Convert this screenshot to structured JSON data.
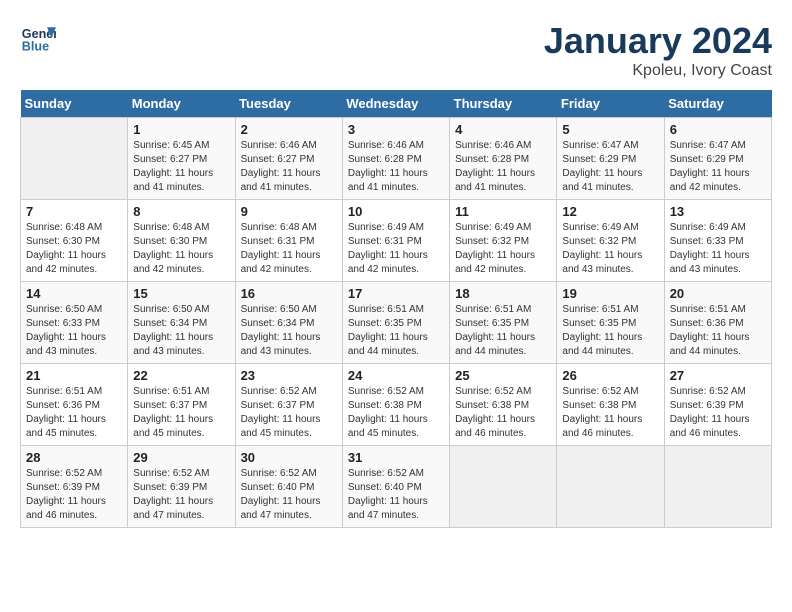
{
  "header": {
    "logo_line1": "General",
    "logo_line2": "Blue",
    "month": "January 2024",
    "location": "Kpoleu, Ivory Coast"
  },
  "days_of_week": [
    "Sunday",
    "Monday",
    "Tuesday",
    "Wednesday",
    "Thursday",
    "Friday",
    "Saturday"
  ],
  "weeks": [
    [
      {
        "day": "",
        "sunrise": "",
        "sunset": "",
        "daylight": ""
      },
      {
        "day": "1",
        "sunrise": "Sunrise: 6:45 AM",
        "sunset": "Sunset: 6:27 PM",
        "daylight": "Daylight: 11 hours and 41 minutes."
      },
      {
        "day": "2",
        "sunrise": "Sunrise: 6:46 AM",
        "sunset": "Sunset: 6:27 PM",
        "daylight": "Daylight: 11 hours and 41 minutes."
      },
      {
        "day": "3",
        "sunrise": "Sunrise: 6:46 AM",
        "sunset": "Sunset: 6:28 PM",
        "daylight": "Daylight: 11 hours and 41 minutes."
      },
      {
        "day": "4",
        "sunrise": "Sunrise: 6:46 AM",
        "sunset": "Sunset: 6:28 PM",
        "daylight": "Daylight: 11 hours and 41 minutes."
      },
      {
        "day": "5",
        "sunrise": "Sunrise: 6:47 AM",
        "sunset": "Sunset: 6:29 PM",
        "daylight": "Daylight: 11 hours and 41 minutes."
      },
      {
        "day": "6",
        "sunrise": "Sunrise: 6:47 AM",
        "sunset": "Sunset: 6:29 PM",
        "daylight": "Daylight: 11 hours and 42 minutes."
      }
    ],
    [
      {
        "day": "7",
        "sunrise": "Sunrise: 6:48 AM",
        "sunset": "Sunset: 6:30 PM",
        "daylight": "Daylight: 11 hours and 42 minutes."
      },
      {
        "day": "8",
        "sunrise": "Sunrise: 6:48 AM",
        "sunset": "Sunset: 6:30 PM",
        "daylight": "Daylight: 11 hours and 42 minutes."
      },
      {
        "day": "9",
        "sunrise": "Sunrise: 6:48 AM",
        "sunset": "Sunset: 6:31 PM",
        "daylight": "Daylight: 11 hours and 42 minutes."
      },
      {
        "day": "10",
        "sunrise": "Sunrise: 6:49 AM",
        "sunset": "Sunset: 6:31 PM",
        "daylight": "Daylight: 11 hours and 42 minutes."
      },
      {
        "day": "11",
        "sunrise": "Sunrise: 6:49 AM",
        "sunset": "Sunset: 6:32 PM",
        "daylight": "Daylight: 11 hours and 42 minutes."
      },
      {
        "day": "12",
        "sunrise": "Sunrise: 6:49 AM",
        "sunset": "Sunset: 6:32 PM",
        "daylight": "Daylight: 11 hours and 43 minutes."
      },
      {
        "day": "13",
        "sunrise": "Sunrise: 6:49 AM",
        "sunset": "Sunset: 6:33 PM",
        "daylight": "Daylight: 11 hours and 43 minutes."
      }
    ],
    [
      {
        "day": "14",
        "sunrise": "Sunrise: 6:50 AM",
        "sunset": "Sunset: 6:33 PM",
        "daylight": "Daylight: 11 hours and 43 minutes."
      },
      {
        "day": "15",
        "sunrise": "Sunrise: 6:50 AM",
        "sunset": "Sunset: 6:34 PM",
        "daylight": "Daylight: 11 hours and 43 minutes."
      },
      {
        "day": "16",
        "sunrise": "Sunrise: 6:50 AM",
        "sunset": "Sunset: 6:34 PM",
        "daylight": "Daylight: 11 hours and 43 minutes."
      },
      {
        "day": "17",
        "sunrise": "Sunrise: 6:51 AM",
        "sunset": "Sunset: 6:35 PM",
        "daylight": "Daylight: 11 hours and 44 minutes."
      },
      {
        "day": "18",
        "sunrise": "Sunrise: 6:51 AM",
        "sunset": "Sunset: 6:35 PM",
        "daylight": "Daylight: 11 hours and 44 minutes."
      },
      {
        "day": "19",
        "sunrise": "Sunrise: 6:51 AM",
        "sunset": "Sunset: 6:35 PM",
        "daylight": "Daylight: 11 hours and 44 minutes."
      },
      {
        "day": "20",
        "sunrise": "Sunrise: 6:51 AM",
        "sunset": "Sunset: 6:36 PM",
        "daylight": "Daylight: 11 hours and 44 minutes."
      }
    ],
    [
      {
        "day": "21",
        "sunrise": "Sunrise: 6:51 AM",
        "sunset": "Sunset: 6:36 PM",
        "daylight": "Daylight: 11 hours and 45 minutes."
      },
      {
        "day": "22",
        "sunrise": "Sunrise: 6:51 AM",
        "sunset": "Sunset: 6:37 PM",
        "daylight": "Daylight: 11 hours and 45 minutes."
      },
      {
        "day": "23",
        "sunrise": "Sunrise: 6:52 AM",
        "sunset": "Sunset: 6:37 PM",
        "daylight": "Daylight: 11 hours and 45 minutes."
      },
      {
        "day": "24",
        "sunrise": "Sunrise: 6:52 AM",
        "sunset": "Sunset: 6:38 PM",
        "daylight": "Daylight: 11 hours and 45 minutes."
      },
      {
        "day": "25",
        "sunrise": "Sunrise: 6:52 AM",
        "sunset": "Sunset: 6:38 PM",
        "daylight": "Daylight: 11 hours and 46 minutes."
      },
      {
        "day": "26",
        "sunrise": "Sunrise: 6:52 AM",
        "sunset": "Sunset: 6:38 PM",
        "daylight": "Daylight: 11 hours and 46 minutes."
      },
      {
        "day": "27",
        "sunrise": "Sunrise: 6:52 AM",
        "sunset": "Sunset: 6:39 PM",
        "daylight": "Daylight: 11 hours and 46 minutes."
      }
    ],
    [
      {
        "day": "28",
        "sunrise": "Sunrise: 6:52 AM",
        "sunset": "Sunset: 6:39 PM",
        "daylight": "Daylight: 11 hours and 46 minutes."
      },
      {
        "day": "29",
        "sunrise": "Sunrise: 6:52 AM",
        "sunset": "Sunset: 6:39 PM",
        "daylight": "Daylight: 11 hours and 47 minutes."
      },
      {
        "day": "30",
        "sunrise": "Sunrise: 6:52 AM",
        "sunset": "Sunset: 6:40 PM",
        "daylight": "Daylight: 11 hours and 47 minutes."
      },
      {
        "day": "31",
        "sunrise": "Sunrise: 6:52 AM",
        "sunset": "Sunset: 6:40 PM",
        "daylight": "Daylight: 11 hours and 47 minutes."
      },
      {
        "day": "",
        "sunrise": "",
        "sunset": "",
        "daylight": ""
      },
      {
        "day": "",
        "sunrise": "",
        "sunset": "",
        "daylight": ""
      },
      {
        "day": "",
        "sunrise": "",
        "sunset": "",
        "daylight": ""
      }
    ]
  ]
}
